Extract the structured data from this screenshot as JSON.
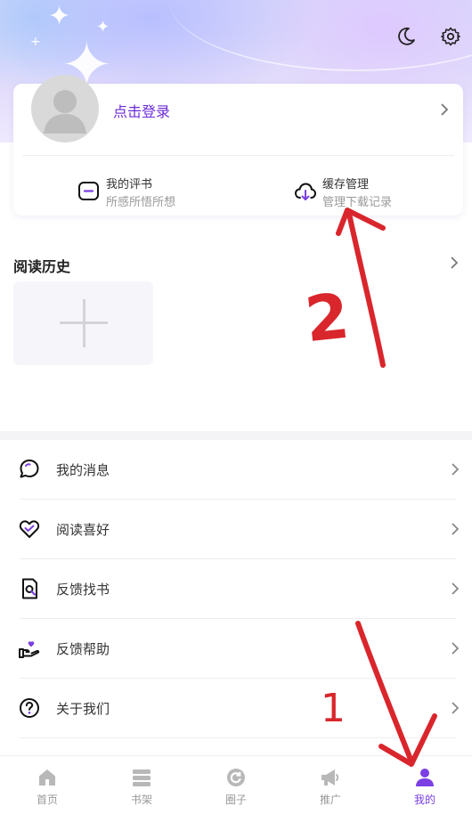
{
  "profile": {
    "login_text": "点击登录"
  },
  "quick_actions": [
    {
      "title": "我的评书",
      "subtitle": "所感所悟所想"
    },
    {
      "title": "缓存管理",
      "subtitle": "管理下载记录"
    }
  ],
  "history": {
    "title": "阅读历史"
  },
  "menu": [
    {
      "label": "我的消息",
      "icon": "message-icon"
    },
    {
      "label": "阅读喜好",
      "icon": "heart-icon"
    },
    {
      "label": "反馈找书",
      "icon": "search-book-icon"
    },
    {
      "label": "反馈帮助",
      "icon": "helping-hand-icon"
    },
    {
      "label": "关于我们",
      "icon": "question-icon"
    }
  ],
  "bottom_nav": [
    {
      "label": "首页",
      "icon": "home-icon",
      "active": false
    },
    {
      "label": "书架",
      "icon": "bookshelf-icon",
      "active": false
    },
    {
      "label": "圈子",
      "icon": "circle-icon",
      "active": false
    },
    {
      "label": "推广",
      "icon": "megaphone-icon",
      "active": false
    },
    {
      "label": "我的",
      "icon": "profile-icon",
      "active": true
    }
  ],
  "annotations": {
    "step_1": "1",
    "step_2": "2"
  },
  "colors": {
    "accent": "#7b3fe4",
    "login_text": "#6c2bd9",
    "annotation": "#d9262c"
  }
}
